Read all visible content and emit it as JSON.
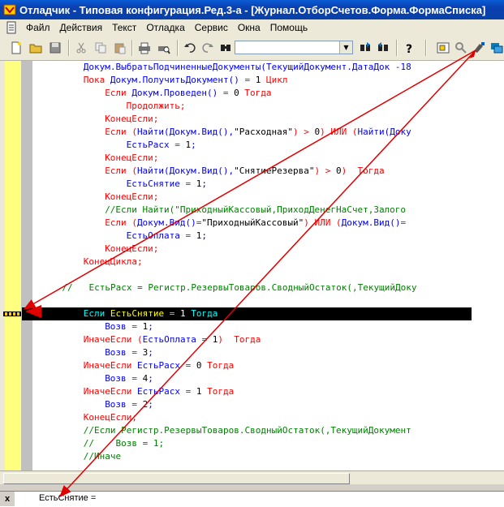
{
  "window": {
    "title": "Отладчик - Типовая конфигурация.Ред.3-а - [Журнал.ОтборСчетов.Форма.ФормаСписка]"
  },
  "menu": {
    "items": [
      {
        "label": "Файл"
      },
      {
        "label": "Действия"
      },
      {
        "label": "Текст"
      },
      {
        "label": "Отладка"
      },
      {
        "label": "Сервис"
      },
      {
        "label": "Окна"
      },
      {
        "label": "Помощь"
      }
    ]
  },
  "toolbar": {
    "buttons": [
      "new-document-icon",
      "open-folder-icon",
      "save-icon",
      "cut-icon",
      "copy-icon",
      "paste-icon",
      "print-icon",
      "print-preview-icon",
      "undo-icon",
      "redo-icon",
      "find-icon",
      "find-next-icon",
      "find-prev-icon",
      "help-icon",
      "module-tree-icon",
      "calculate-expression-icon",
      "watch-icon",
      "stack-icon"
    ],
    "search_value": ""
  },
  "code": {
    "lines": [
      {
        "indent": 8,
        "parts": [
          [
            "id",
            "Докум.ВыбратьПодчиненныеДокументы(ТекущийДокумент.ДатаДок -18"
          ]
        ]
      },
      {
        "indent": 8,
        "parts": [
          [
            "kw",
            "Пока "
          ],
          [
            "id",
            "Докум.ПолучитьДокумент() "
          ],
          [
            "op",
            "= "
          ],
          [
            "num",
            "1 "
          ],
          [
            "kw",
            "Цикл"
          ]
        ]
      },
      {
        "indent": 12,
        "parts": [
          [
            "kw",
            "Если "
          ],
          [
            "id",
            "Докум.Проведен() "
          ],
          [
            "op",
            "= "
          ],
          [
            "num",
            "0 "
          ],
          [
            "kw",
            "Тогда"
          ]
        ]
      },
      {
        "indent": 16,
        "parts": [
          [
            "kw",
            "Продолжить;"
          ]
        ]
      },
      {
        "indent": 12,
        "parts": [
          [
            "kw",
            "КонецЕсли;"
          ]
        ]
      },
      {
        "indent": 12,
        "parts": [
          [
            "kw",
            "Если "
          ],
          [
            "op",
            "("
          ],
          [
            "id",
            "Найти(Докум.Вид(),"
          ],
          [
            "str",
            "\"Расходная\""
          ],
          [
            "op",
            ") > "
          ],
          [
            "num",
            "0"
          ],
          [
            "op",
            ") ИЛИ ("
          ],
          [
            "id",
            "Найти(Доку"
          ]
        ]
      },
      {
        "indent": 16,
        "parts": [
          [
            "id",
            "ЕстьРасх "
          ],
          [
            "op",
            "= "
          ],
          [
            "num",
            "1"
          ],
          [
            "id",
            ";"
          ]
        ]
      },
      {
        "indent": 12,
        "parts": [
          [
            "kw",
            "КонецЕсли;"
          ]
        ]
      },
      {
        "indent": 12,
        "parts": [
          [
            "kw",
            "Если "
          ],
          [
            "op",
            "("
          ],
          [
            "id",
            "Найти(Докум.Вид(),"
          ],
          [
            "str",
            "\"СнятиеРезерва\""
          ],
          [
            "op",
            ") > "
          ],
          [
            "num",
            "0"
          ],
          [
            "op",
            ")  "
          ],
          [
            "kw",
            "Тогда"
          ]
        ]
      },
      {
        "indent": 16,
        "parts": [
          [
            "id",
            "ЕстьСнятие "
          ],
          [
            "op",
            "= "
          ],
          [
            "num",
            "1"
          ],
          [
            "id",
            ";"
          ]
        ]
      },
      {
        "indent": 12,
        "parts": [
          [
            "kw",
            "КонецЕсли;"
          ]
        ]
      },
      {
        "indent": 12,
        "parts": [
          [
            "cm",
            "//Если Найти(\"ПриходныйКассовый,ПриходДенегНаСчет,Залого"
          ]
        ]
      },
      {
        "indent": 12,
        "parts": [
          [
            "kw",
            "Если "
          ],
          [
            "op",
            "("
          ],
          [
            "id",
            "Докум.Вид()"
          ],
          [
            "op",
            "="
          ],
          [
            "str",
            "\"ПриходныйКассовый\""
          ],
          [
            "op",
            ") ИЛИ ("
          ],
          [
            "id",
            "Докум.Вид()"
          ],
          [
            "op",
            "="
          ]
        ]
      },
      {
        "indent": 16,
        "parts": [
          [
            "id",
            "ЕстьОплата "
          ],
          [
            "op",
            "= "
          ],
          [
            "num",
            "1"
          ],
          [
            "id",
            ";"
          ]
        ]
      },
      {
        "indent": 12,
        "parts": [
          [
            "kw",
            "КонецЕсли;"
          ]
        ]
      },
      {
        "indent": 8,
        "parts": [
          [
            "kw",
            "КонецЦикла;"
          ]
        ]
      },
      {
        "indent": 0,
        "parts": []
      },
      {
        "indent": 4,
        "parts": [
          [
            "cm",
            "//   ЕстьРасх = Регистр.РезервыТоваров.СводныйОстаток(,ТекущийДоку"
          ]
        ]
      },
      {
        "indent": 0,
        "parts": []
      },
      {
        "indent": 8,
        "current": true,
        "parts": [
          [
            "kwc",
            "Если "
          ],
          [
            "idc",
            "ЕстьСнятие "
          ],
          [
            "opc",
            "= "
          ],
          [
            "numc",
            "1 "
          ],
          [
            "kwc",
            "Тогда"
          ]
        ]
      },
      {
        "indent": 12,
        "parts": [
          [
            "id",
            "Возв "
          ],
          [
            "op",
            "= "
          ],
          [
            "num",
            "1"
          ],
          [
            "id",
            ";"
          ]
        ]
      },
      {
        "indent": 8,
        "parts": [
          [
            "kw",
            "ИначеЕсли "
          ],
          [
            "op",
            "("
          ],
          [
            "id",
            "ЕстьОплата "
          ],
          [
            "op",
            "= "
          ],
          [
            "num",
            "1"
          ],
          [
            "op",
            ")  "
          ],
          [
            "kw",
            "Тогда"
          ]
        ]
      },
      {
        "indent": 12,
        "parts": [
          [
            "id",
            "Возв "
          ],
          [
            "op",
            "= "
          ],
          [
            "num",
            "3"
          ],
          [
            "id",
            ";"
          ]
        ]
      },
      {
        "indent": 8,
        "parts": [
          [
            "kw",
            "ИначеЕсли "
          ],
          [
            "id",
            "ЕстьРасх "
          ],
          [
            "op",
            "= "
          ],
          [
            "num",
            "0 "
          ],
          [
            "kw",
            "Тогда"
          ]
        ]
      },
      {
        "indent": 12,
        "parts": [
          [
            "id",
            "Возв "
          ],
          [
            "op",
            "= "
          ],
          [
            "num",
            "4"
          ],
          [
            "id",
            ";"
          ]
        ]
      },
      {
        "indent": 8,
        "parts": [
          [
            "kw",
            "ИначеЕсли "
          ],
          [
            "id",
            "ЕстьРасх "
          ],
          [
            "op",
            "= "
          ],
          [
            "num",
            "1 "
          ],
          [
            "kw",
            "Тогда"
          ]
        ]
      },
      {
        "indent": 12,
        "parts": [
          [
            "id",
            "Возв "
          ],
          [
            "op",
            "= "
          ],
          [
            "num",
            "2"
          ],
          [
            "id",
            ";"
          ]
        ]
      },
      {
        "indent": 8,
        "parts": [
          [
            "kw",
            "КонецЕсли;"
          ]
        ]
      },
      {
        "indent": 8,
        "parts": [
          [
            "cm",
            "//Если Регистр.РезервыТоваров.СводныйОстаток(,ТекущийДокумент"
          ]
        ]
      },
      {
        "indent": 8,
        "parts": [
          [
            "cm",
            "//    Возв = 1;"
          ]
        ]
      },
      {
        "indent": 8,
        "parts": [
          [
            "cm",
            "//Иначе"
          ]
        ]
      }
    ]
  },
  "watch": {
    "expression": "ЕстьСнятие =",
    "close_glyph": "x"
  },
  "colors": {
    "keyword": "#ff0000",
    "identifier": "#0000ff",
    "comment": "#008000",
    "current_line_bg": "#000000",
    "gutter": "#ffff80",
    "arrow": "#e00000"
  }
}
